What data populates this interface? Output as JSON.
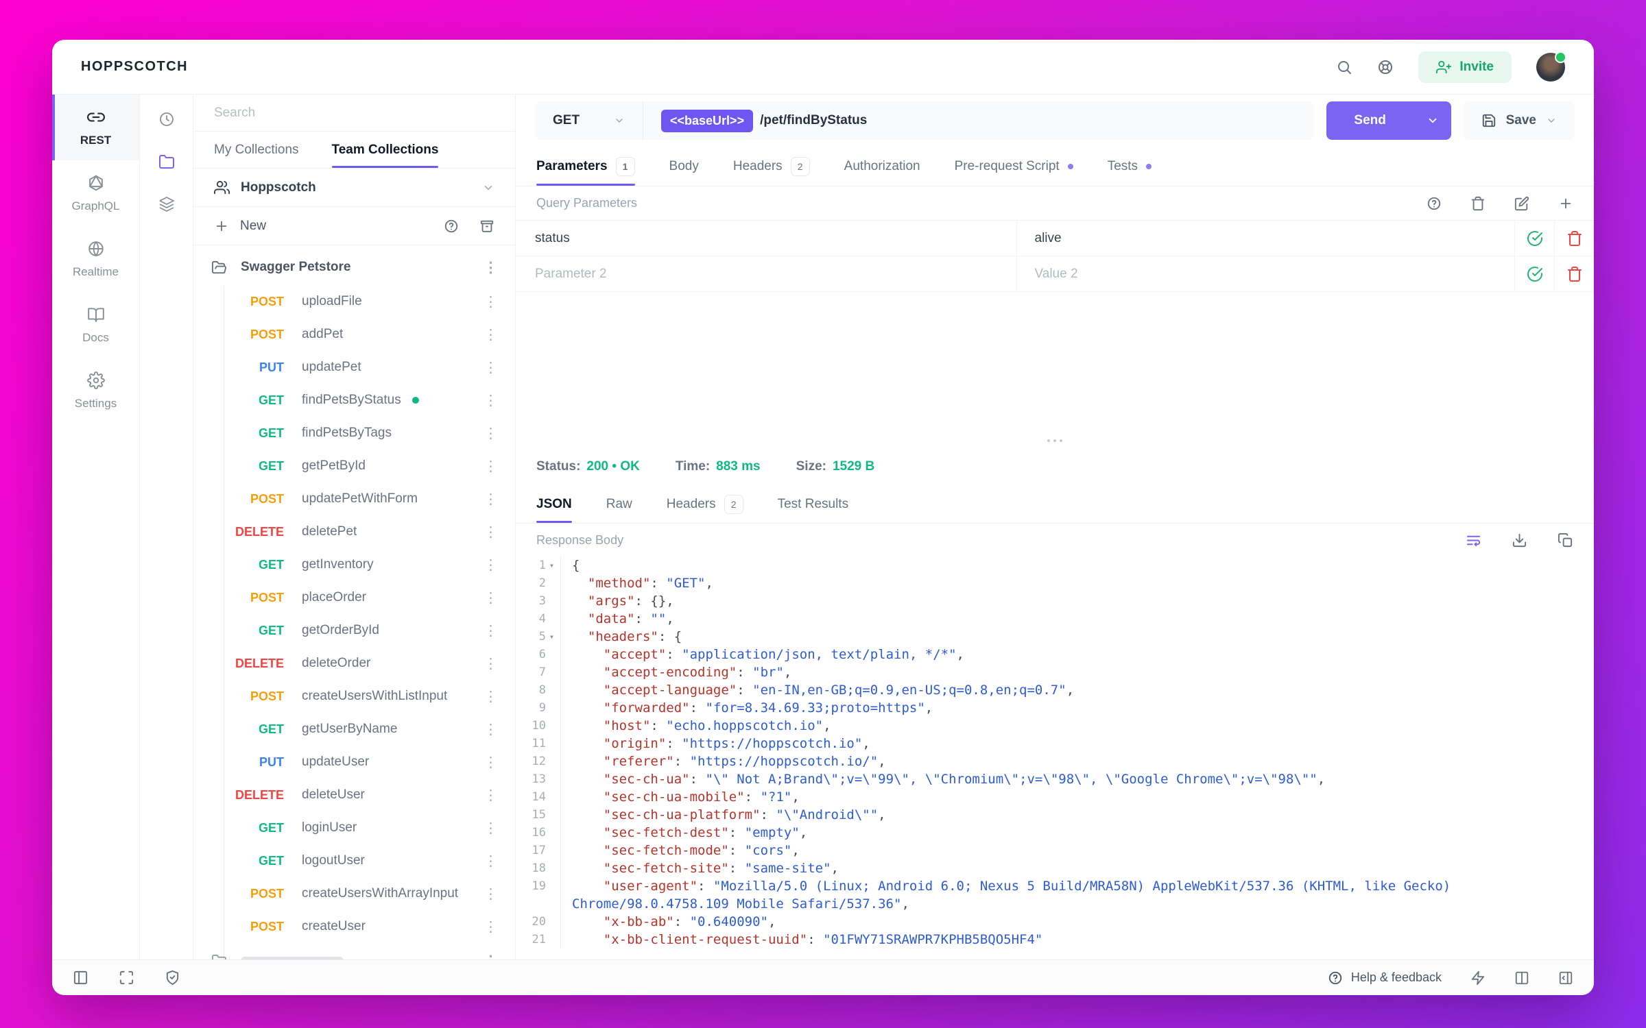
{
  "topbar": {
    "title": "HOPPSCOTCH",
    "invite_label": "Invite"
  },
  "nav": {
    "items": [
      {
        "label": "REST",
        "active": true
      },
      {
        "label": "GraphQL"
      },
      {
        "label": "Realtime"
      },
      {
        "label": "Docs"
      },
      {
        "label": "Settings"
      }
    ]
  },
  "collections": {
    "search_placeholder": "Search",
    "tabs": [
      {
        "label": "My Collections"
      },
      {
        "label": "Team Collections",
        "active": true
      }
    ],
    "team_name": "Hoppscotch",
    "new_label": "New",
    "folder_name": "Swagger Petstore",
    "requests": [
      {
        "method": "POST",
        "name": "uploadFile"
      },
      {
        "method": "POST",
        "name": "addPet"
      },
      {
        "method": "PUT",
        "name": "updatePet"
      },
      {
        "method": "GET",
        "name": "findPetsByStatus",
        "active": true
      },
      {
        "method": "GET",
        "name": "findPetsByTags"
      },
      {
        "method": "GET",
        "name": "getPetById"
      },
      {
        "method": "POST",
        "name": "updatePetWithForm"
      },
      {
        "method": "DELETE",
        "name": "deletePet"
      },
      {
        "method": "GET",
        "name": "getInventory"
      },
      {
        "method": "POST",
        "name": "placeOrder"
      },
      {
        "method": "GET",
        "name": "getOrderById"
      },
      {
        "method": "DELETE",
        "name": "deleteOrder"
      },
      {
        "method": "POST",
        "name": "createUsersWithListInput"
      },
      {
        "method": "GET",
        "name": "getUserByName"
      },
      {
        "method": "PUT",
        "name": "updateUser"
      },
      {
        "method": "DELETE",
        "name": "deleteUser"
      },
      {
        "method": "GET",
        "name": "loginUser"
      },
      {
        "method": "GET",
        "name": "logoutUser"
      },
      {
        "method": "POST",
        "name": "createUsersWithArrayInput"
      },
      {
        "method": "POST",
        "name": "createUser"
      }
    ]
  },
  "request": {
    "method": "GET",
    "base_url_chip": "<<baseUrl>>",
    "path": "/pet/findByStatus",
    "send_label": "Send",
    "save_label": "Save",
    "tabs": [
      {
        "label": "Parameters",
        "badge": "1",
        "active": true
      },
      {
        "label": "Body"
      },
      {
        "label": "Headers",
        "badge": "2"
      },
      {
        "label": "Authorization"
      },
      {
        "label": "Pre-request Script",
        "dot": true
      },
      {
        "label": "Tests",
        "dot": true
      }
    ],
    "section_title": "Query Parameters",
    "params": [
      {
        "name": "status",
        "value": "alive"
      },
      {
        "name": "Parameter 2",
        "value": "Value 2",
        "is_placeholder": true
      }
    ]
  },
  "response": {
    "status_label": "Status:",
    "status_value": "200 • OK",
    "time_label": "Time:",
    "time_value": "883 ms",
    "size_label": "Size:",
    "size_value": "1529 B",
    "tabs": [
      {
        "label": "JSON",
        "active": true
      },
      {
        "label": "Raw"
      },
      {
        "label": "Headers",
        "badge": "2"
      },
      {
        "label": "Test Results"
      }
    ],
    "body_label": "Response Body",
    "code_lines": [
      {
        "n": "1",
        "fold": true,
        "segs": [
          [
            "p",
            "{"
          ]
        ]
      },
      {
        "n": "2",
        "segs": [
          [
            "w",
            "  "
          ],
          [
            "k",
            "\"method\""
          ],
          [
            "p",
            ": "
          ],
          [
            "s",
            "\"GET\""
          ],
          [
            "p",
            ","
          ]
        ]
      },
      {
        "n": "3",
        "segs": [
          [
            "w",
            "  "
          ],
          [
            "k",
            "\"args\""
          ],
          [
            "p",
            ": {},"
          ]
        ]
      },
      {
        "n": "4",
        "segs": [
          [
            "w",
            "  "
          ],
          [
            "k",
            "\"data\""
          ],
          [
            "p",
            ": "
          ],
          [
            "s",
            "\"\""
          ],
          [
            "p",
            ","
          ]
        ]
      },
      {
        "n": "5",
        "fold": true,
        "segs": [
          [
            "w",
            "  "
          ],
          [
            "k",
            "\"headers\""
          ],
          [
            "p",
            ": {"
          ]
        ]
      },
      {
        "n": "6",
        "segs": [
          [
            "w",
            "    "
          ],
          [
            "k",
            "\"accept\""
          ],
          [
            "p",
            ": "
          ],
          [
            "s",
            "\"application/json, text/plain, */*\""
          ],
          [
            "p",
            ","
          ]
        ]
      },
      {
        "n": "7",
        "segs": [
          [
            "w",
            "    "
          ],
          [
            "k",
            "\"accept-encoding\""
          ],
          [
            "p",
            ": "
          ],
          [
            "s",
            "\"br\""
          ],
          [
            "p",
            ","
          ]
        ]
      },
      {
        "n": "8",
        "segs": [
          [
            "w",
            "    "
          ],
          [
            "k",
            "\"accept-language\""
          ],
          [
            "p",
            ": "
          ],
          [
            "s",
            "\"en-IN,en-GB;q=0.9,en-US;q=0.8,en;q=0.7\""
          ],
          [
            "p",
            ","
          ]
        ]
      },
      {
        "n": "9",
        "segs": [
          [
            "w",
            "    "
          ],
          [
            "k",
            "\"forwarded\""
          ],
          [
            "p",
            ": "
          ],
          [
            "s",
            "\"for=8.34.69.33;proto=https\""
          ],
          [
            "p",
            ","
          ]
        ]
      },
      {
        "n": "10",
        "segs": [
          [
            "w",
            "    "
          ],
          [
            "k",
            "\"host\""
          ],
          [
            "p",
            ": "
          ],
          [
            "s",
            "\"echo.hoppscotch.io\""
          ],
          [
            "p",
            ","
          ]
        ]
      },
      {
        "n": "11",
        "segs": [
          [
            "w",
            "    "
          ],
          [
            "k",
            "\"origin\""
          ],
          [
            "p",
            ": "
          ],
          [
            "s",
            "\"https://hoppscotch.io\""
          ],
          [
            "p",
            ","
          ]
        ]
      },
      {
        "n": "12",
        "segs": [
          [
            "w",
            "    "
          ],
          [
            "k",
            "\"referer\""
          ],
          [
            "p",
            ": "
          ],
          [
            "s",
            "\"https://hoppscotch.io/\""
          ],
          [
            "p",
            ","
          ]
        ]
      },
      {
        "n": "13",
        "segs": [
          [
            "w",
            "    "
          ],
          [
            "k",
            "\"sec-ch-ua\""
          ],
          [
            "p",
            ": "
          ],
          [
            "s",
            "\"\\\" Not A;Brand\\\";v=\\\"99\\\", \\\"Chromium\\\";v=\\\"98\\\", \\\"Google Chrome\\\";v=\\\"98\\\"\""
          ],
          [
            "p",
            ","
          ]
        ]
      },
      {
        "n": "14",
        "segs": [
          [
            "w",
            "    "
          ],
          [
            "k",
            "\"sec-ch-ua-mobile\""
          ],
          [
            "p",
            ": "
          ],
          [
            "s",
            "\"?1\""
          ],
          [
            "p",
            ","
          ]
        ]
      },
      {
        "n": "15",
        "segs": [
          [
            "w",
            "    "
          ],
          [
            "k",
            "\"sec-ch-ua-platform\""
          ],
          [
            "p",
            ": "
          ],
          [
            "s",
            "\"\\\"Android\\\"\""
          ],
          [
            "p",
            ","
          ]
        ]
      },
      {
        "n": "16",
        "segs": [
          [
            "w",
            "    "
          ],
          [
            "k",
            "\"sec-fetch-dest\""
          ],
          [
            "p",
            ": "
          ],
          [
            "s",
            "\"empty\""
          ],
          [
            "p",
            ","
          ]
        ]
      },
      {
        "n": "17",
        "segs": [
          [
            "w",
            "    "
          ],
          [
            "k",
            "\"sec-fetch-mode\""
          ],
          [
            "p",
            ": "
          ],
          [
            "s",
            "\"cors\""
          ],
          [
            "p",
            ","
          ]
        ]
      },
      {
        "n": "18",
        "segs": [
          [
            "w",
            "    "
          ],
          [
            "k",
            "\"sec-fetch-site\""
          ],
          [
            "p",
            ": "
          ],
          [
            "s",
            "\"same-site\""
          ],
          [
            "p",
            ","
          ]
        ]
      },
      {
        "n": "19",
        "segs": [
          [
            "w",
            "    "
          ],
          [
            "k",
            "\"user-agent\""
          ],
          [
            "p",
            ": "
          ],
          [
            "s",
            "\"Mozilla/5.0 (Linux; Android 6.0; Nexus 5 Build/MRA58N) AppleWebKit/537.36 (KHTML, like Gecko) Chrome/98.0.4758.109 Mobile Safari/537.36\""
          ],
          [
            "p",
            ","
          ]
        ]
      },
      {
        "n": "20",
        "segs": [
          [
            "w",
            "    "
          ],
          [
            "k",
            "\"x-bb-ab\""
          ],
          [
            "p",
            ": "
          ],
          [
            "s",
            "\"0.640090\""
          ],
          [
            "p",
            ","
          ]
        ]
      },
      {
        "n": "21",
        "segs": [
          [
            "w",
            "    "
          ],
          [
            "k",
            "\"x-bb-client-request-uuid\""
          ],
          [
            "p",
            ": "
          ],
          [
            "s",
            "\"01FWY71SRAWPR7KPHB5BQO5HF4\""
          ]
        ]
      }
    ]
  },
  "footer": {
    "help_label": "Help & feedback"
  }
}
